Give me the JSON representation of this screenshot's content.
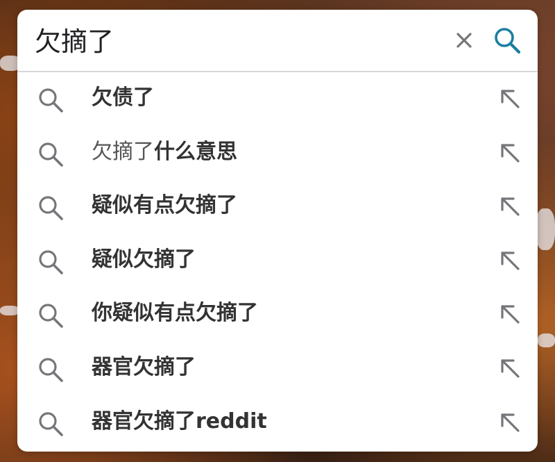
{
  "search": {
    "query": "欠摘了",
    "clear_icon": "close-icon",
    "search_icon": "search-icon",
    "accent_color": "#1a7fa0"
  },
  "suggestions": [
    {
      "prefix": "",
      "rest": "欠债了"
    },
    {
      "prefix": "欠摘了",
      "rest": "什么意思"
    },
    {
      "prefix": "",
      "rest": "疑似有点欠摘了"
    },
    {
      "prefix": "",
      "rest": "疑似欠摘了"
    },
    {
      "prefix": "",
      "rest": "你疑似有点欠摘了"
    },
    {
      "prefix": "",
      "rest": "器官欠摘了"
    },
    {
      "prefix": "",
      "rest": "器官欠摘了reddit"
    }
  ],
  "icons": {
    "suggestion_icon": "search-icon",
    "fill_icon": "arrow-up-left-icon"
  }
}
